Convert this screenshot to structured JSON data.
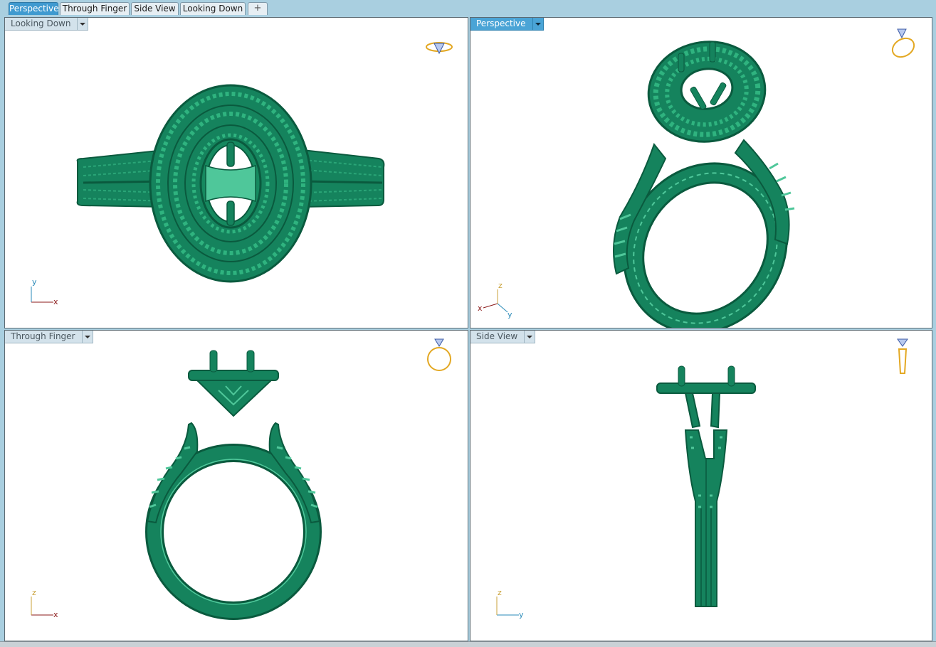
{
  "tabs": [
    {
      "label": "Perspective",
      "active": true
    },
    {
      "label": "Through Finger",
      "active": false
    },
    {
      "label": "Side View",
      "active": false
    },
    {
      "label": "Looking Down",
      "active": false
    }
  ],
  "add_tab_icon": "plus-icon",
  "viewports": {
    "looking_down": {
      "title": "Looking Down",
      "axis_labels": {
        "x": "x",
        "y": "y"
      },
      "cube_icon": "ring-top-view-icon"
    },
    "perspective": {
      "title": "Perspective",
      "axis_labels": {
        "x": "x",
        "y": "y",
        "z": "z"
      },
      "cube_icon": "ring-perspective-icon"
    },
    "through_finger": {
      "title": "Through Finger",
      "axis_labels": {
        "x": "x",
        "z": "z"
      },
      "cube_icon": "ring-front-view-icon"
    },
    "side_view": {
      "title": "Side View",
      "axis_labels": {
        "y": "y",
        "z": "z"
      },
      "cube_icon": "ring-side-view-icon"
    }
  },
  "colors": {
    "model": "#15835d",
    "model_dark": "#0a5a3e",
    "model_light": "#4fc79a",
    "axis_x": "#8b1a1a",
    "axis_y": "#2a8ab8",
    "axis_z": "#c9a23a",
    "active": "#4aa4d6"
  }
}
